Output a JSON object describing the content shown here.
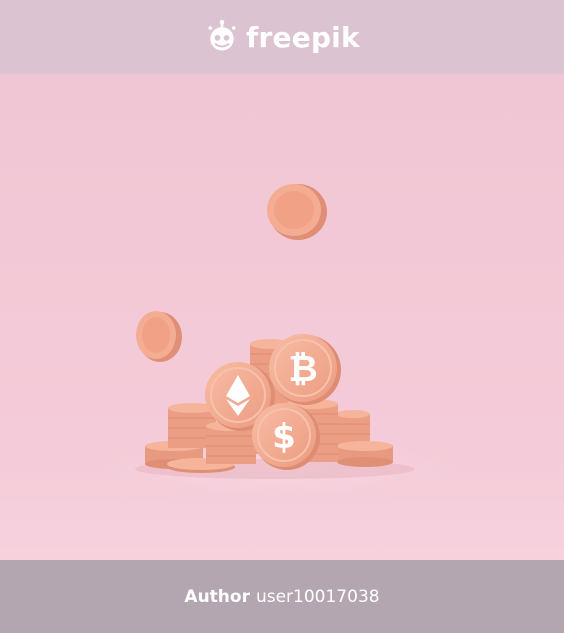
{
  "header": {
    "brand_name": "freepik",
    "logo_icon": "freepik-robot-logo-icon"
  },
  "footer": {
    "author_label": "Author",
    "author_name": "user10017038"
  },
  "image": {
    "subject": "pile of coins",
    "coin_icons": [
      "bitcoin-symbol-icon",
      "ethereum-symbol-icon",
      "dollar-symbol-icon"
    ],
    "colors": {
      "background": "#f2c9d7",
      "coin": "#f2a98f",
      "coin_shadow": "#e08f76",
      "top_bar": "#dcc3d1",
      "bottom_bar": "#b3a6b1"
    }
  }
}
